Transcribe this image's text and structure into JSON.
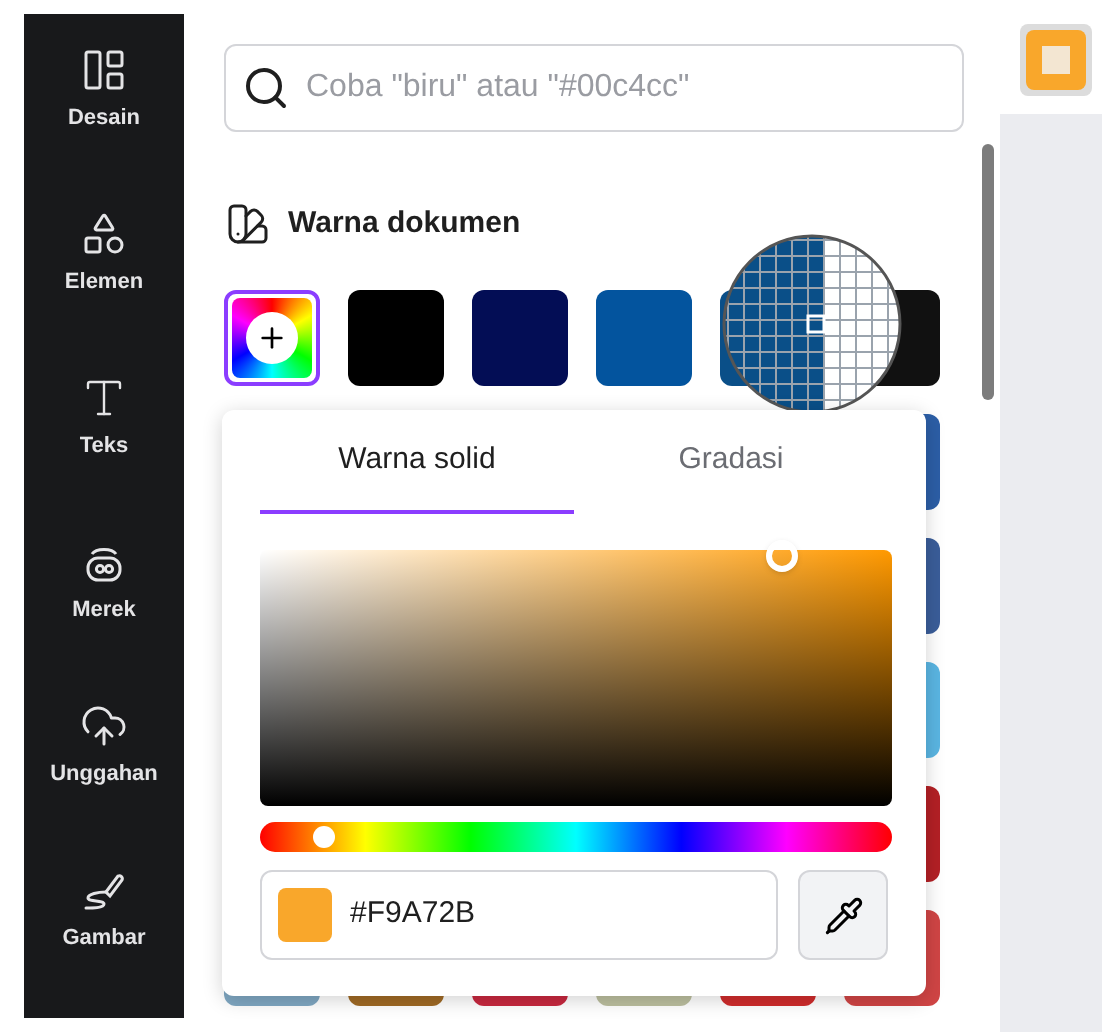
{
  "sidebar": {
    "items": [
      {
        "kind": "design",
        "label": "Desain"
      },
      {
        "kind": "elements",
        "label": "Elemen"
      },
      {
        "kind": "text",
        "label": "Teks"
      },
      {
        "kind": "brand",
        "label": "Merek"
      },
      {
        "kind": "uploads",
        "label": "Unggahan"
      },
      {
        "kind": "draw",
        "label": "Gambar"
      }
    ]
  },
  "search": {
    "placeholder": "Coba \"biru\" atau \"#00c4cc\""
  },
  "document_colors": {
    "title": "Warna dokumen",
    "swatch_rows": [
      [
        {
          "kind": "add"
        },
        {
          "color": "#000000"
        },
        {
          "color": "#030d55"
        },
        {
          "color": "#03549e"
        },
        {
          "color": "#0a4f88"
        },
        {
          "color": "#111111"
        }
      ],
      [
        {
          "color": "#2c5ea6"
        }
      ],
      [
        {
          "color": "#3a5d99"
        }
      ],
      [
        {
          "color": "#5ab5e2"
        }
      ],
      [
        {
          "color": "#b32025"
        }
      ],
      [
        {
          "color": "#7fa7c2"
        },
        {
          "color": "#a06a25"
        },
        {
          "color": "#c8283f"
        },
        {
          "color": "#bcbf9f"
        },
        {
          "color": "#d02c2c"
        },
        {
          "color": "#d04545"
        }
      ]
    ]
  },
  "color_picker": {
    "tabs": [
      {
        "label": "Warna solid",
        "selected": true
      },
      {
        "label": "Gradasi",
        "selected": false
      }
    ],
    "hue_slider": {
      "level": 0.1
    },
    "hex_value": "#F9A72B"
  }
}
